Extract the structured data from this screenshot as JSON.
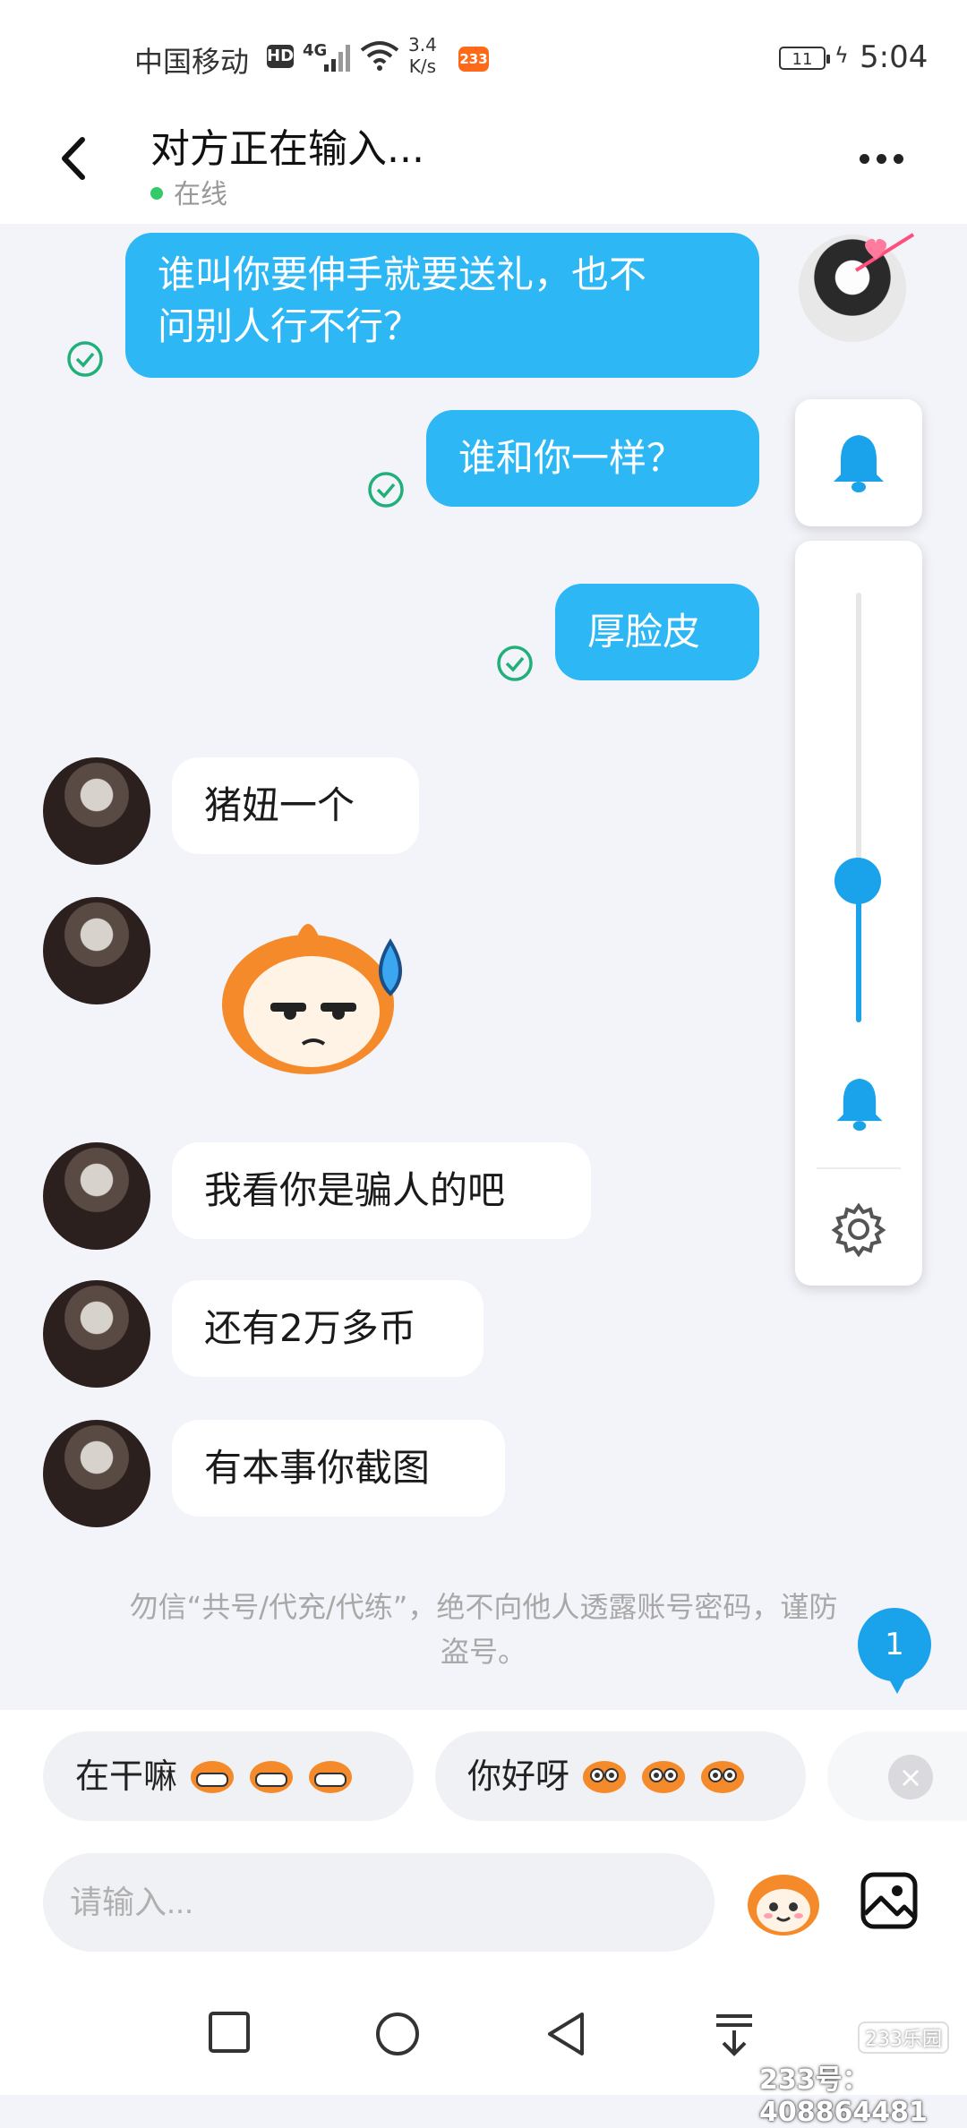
{
  "status_bar": {
    "carrier": "中国移动",
    "hd": "HD",
    "network": "4G",
    "speed_value": "3.4",
    "speed_unit": "K/s",
    "app_badge": "233",
    "battery": "11",
    "time": "5:04"
  },
  "header": {
    "title": "对方正在输入...",
    "presence": "在线"
  },
  "messages": [
    {
      "side": "out",
      "text_line1": "谁叫你要伸手就要送礼，也不",
      "text_line2": "问别人行不行？"
    },
    {
      "side": "out",
      "text": "谁和你一样？"
    },
    {
      "side": "out",
      "text": "厚脸皮"
    },
    {
      "side": "in",
      "text": "猪妞一个"
    },
    {
      "side": "in",
      "type": "sticker"
    },
    {
      "side": "in",
      "text": "我看你是骗人的吧"
    },
    {
      "side": "in",
      "text": "还有2万多币"
    },
    {
      "side": "in",
      "text": "有本事你截图"
    }
  ],
  "volume_panel": {
    "level": 0.33
  },
  "notice": {
    "line1": "勿信“共号/代充/代练”，绝不向他人透露账号密码，谨防",
    "line2": "盗号。"
  },
  "unread_count": "1",
  "quick_replies": [
    {
      "label": "在干嘛"
    },
    {
      "label": "你好呀"
    }
  ],
  "input": {
    "placeholder": "请输入..."
  },
  "watermark": {
    "text": "233号：408864481",
    "logo": "233乐园"
  },
  "colors": {
    "accent": "#2eb7f5",
    "read_check": "#21b07a",
    "online": "#35c96a"
  }
}
